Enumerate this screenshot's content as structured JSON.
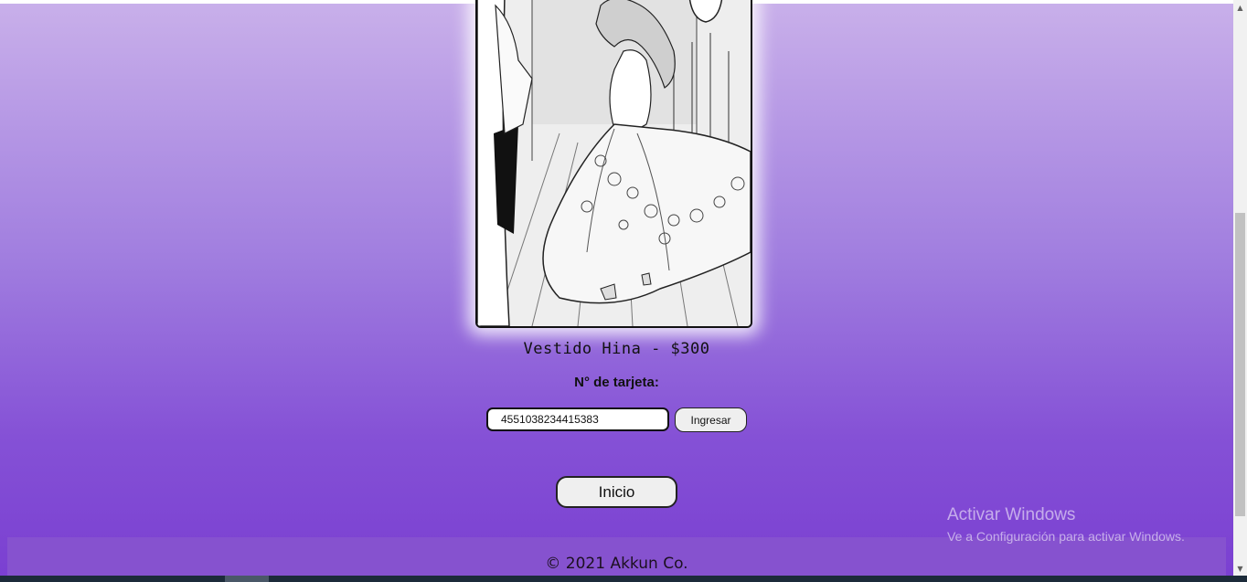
{
  "product": {
    "title": "Vestido Hina - $300",
    "image_alt": "manga illustration of a girl in a flowing floral wedding dress"
  },
  "payment": {
    "card_label": "N° de tarjeta:",
    "card_value": "4551038234415383",
    "submit_label": "Ingresar"
  },
  "navigation": {
    "home_label": "Inicio"
  },
  "footer": {
    "text": "© 2021 Akkun Co."
  },
  "watermark": {
    "title": "Activar Windows",
    "subtitle": "Ve a Configuración para activar Windows."
  },
  "colors": {
    "background_top": "#c9b0ea",
    "background_bottom": "#7a3fd1",
    "footer": "#8652cf"
  }
}
